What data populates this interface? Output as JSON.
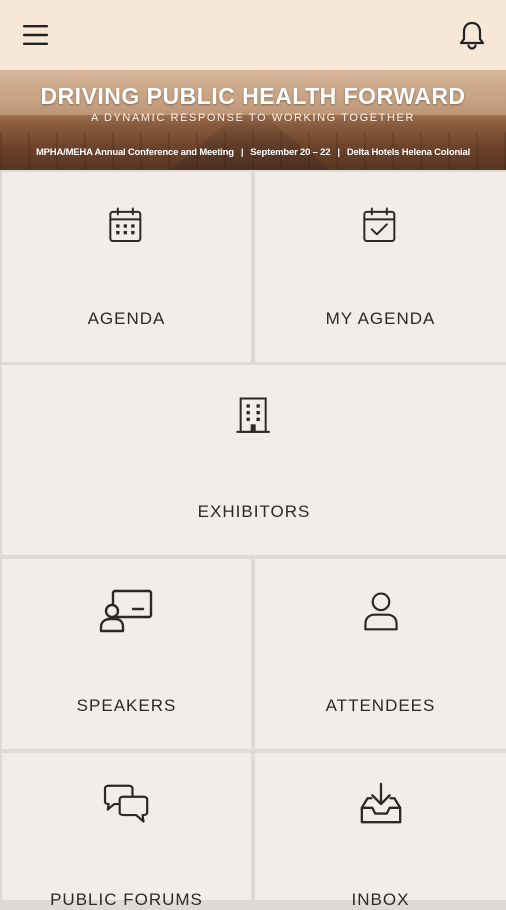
{
  "header": {
    "menu_icon": "hamburger-menu-icon",
    "notification_icon": "bell-icon"
  },
  "banner": {
    "title": "DRIVING PUBLIC HEALTH FORWARD",
    "subtitle": "A DYNAMIC RESPONSE TO WORKING TOGETHER",
    "event_name": "MPHA/MEHA Annual Conference and Meeting",
    "dates": "September 20 – 22",
    "venue": "Delta Hotels Helena Colonial"
  },
  "tiles": [
    {
      "label": "AGENDA",
      "icon": "calendar-icon"
    },
    {
      "label": "MY AGENDA",
      "icon": "calendar-check-icon"
    },
    {
      "label": "EXHIBITORS",
      "icon": "building-icon"
    },
    {
      "label": "SPEAKERS",
      "icon": "presenter-icon"
    },
    {
      "label": "ATTENDEES",
      "icon": "person-icon"
    },
    {
      "label": "PUBLIC FORUMS",
      "icon": "chat-bubbles-icon"
    },
    {
      "label": "INBOX",
      "icon": "inbox-download-icon"
    }
  ],
  "colors": {
    "header_bg": "#f7e7d7",
    "tile_bg": "#f2ede8",
    "grid_line": "#dedad5",
    "text": "#2a2a2a"
  }
}
